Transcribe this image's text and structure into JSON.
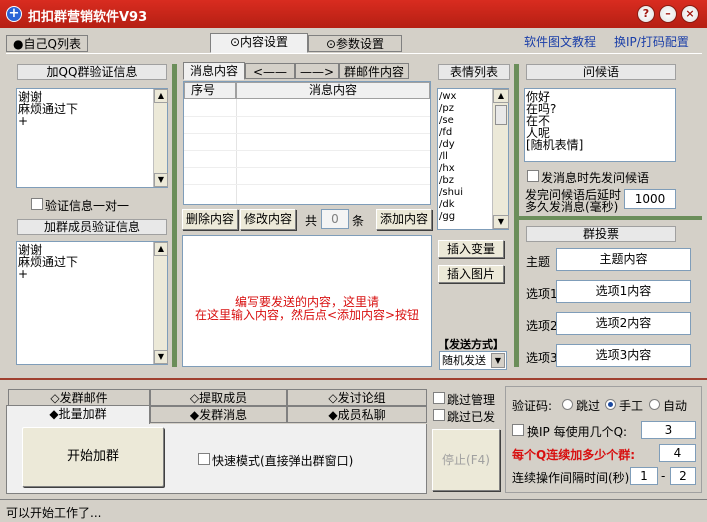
{
  "window": {
    "title": "扣扣群营销软件V93",
    "btn_help": "?",
    "btn_min": "–",
    "btn_close": "×"
  },
  "top_tabs": {
    "own_qq": "●自己Q列表",
    "content_settings": "⊙内容设置",
    "param_settings": "⊙参数设置"
  },
  "links": {
    "tutorial": "软件图文教程",
    "ip_settings": "换IP/打码配置"
  },
  "verify": {
    "join_header": "加QQ群验证信息",
    "join_text": "谢谢\n麻烦通过下\n+",
    "one_to_one_label": "验证信息一对一",
    "member_header": "加群成员验证信息",
    "member_text": "谢谢\n麻烦通过下\n+"
  },
  "content": {
    "tabs": [
      "消息内容",
      "<——",
      "——>",
      "群邮件内容"
    ],
    "columns": [
      "序号",
      "消息内容"
    ],
    "delete_btn": "删除内容",
    "modify_btn": "修改内容",
    "total_prefix": "共",
    "count": "0",
    "total_suffix": "条",
    "add_btn": "添加内容",
    "hint_line1": "编写要发送的内容，这里请",
    "hint_line2": "在这里输入内容，然后点<添加内容>按钮"
  },
  "emoji": {
    "header": "表情列表",
    "items": [
      "/wx",
      "/pz",
      "/se",
      "/fd",
      "/dy",
      "/ll",
      "/hx",
      "/bz",
      "/shui",
      "/dk",
      "/gg"
    ],
    "insert_var": "插入变量",
    "insert_img": "插入图片",
    "send_mode_label": "【发送方式】",
    "send_mode_value": "随机发送"
  },
  "greeting": {
    "header": "问候语",
    "text": "你好\n在吗?\n在不\n人呢\n[随机表情]",
    "first_label": "发消息时先发问候语",
    "delay_label_1": "发完问候语后延时",
    "delay_label_2": "多久发消息(毫秒)",
    "delay_value": "1000"
  },
  "vote": {
    "header": "群投票",
    "topic_label": "主题",
    "topic_value": "主题内容",
    "opt1_label": "选项1",
    "opt1_value": "选项1内容",
    "opt2_label": "选项2",
    "opt2_value": "选项2内容",
    "opt3_label": "选项3",
    "opt3_value": "选项3内容"
  },
  "bottom": {
    "tabs_row1": [
      "◇发群邮件",
      "◇提取成员",
      "◇发讨论组"
    ],
    "tabs_row2": [
      "◆批量加群",
      "◆发群消息",
      "◆成员私聊"
    ],
    "start_btn": "开始加群",
    "fast_mode": "快速模式(直接弹出群窗口)",
    "stop_btn": "停止(F4)",
    "skip_admin": "跳过管理",
    "skip_sent": "跳过已发"
  },
  "settings": {
    "captcha_label": "验证码:",
    "captcha_opts": [
      "跳过",
      "手工",
      "自动"
    ],
    "change_ip_label": "换IP  每使用几个Q:",
    "change_ip_value": "3",
    "per_q_label": "每个Q连续加多少个群:",
    "per_q_value": "4",
    "interval_label": "连续操作间隔时间(秒)",
    "interval_min": "1",
    "interval_dash": "-",
    "interval_max": "2"
  },
  "status": {
    "text": "可以开始工作了..."
  }
}
